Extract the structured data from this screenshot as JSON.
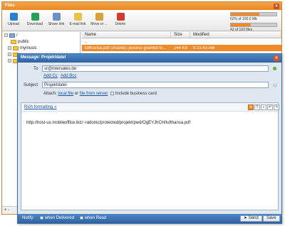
{
  "files_window": {
    "title": "Files",
    "toolbar": [
      {
        "label": "Upload",
        "icon": "upload-icon"
      },
      {
        "label": "Download",
        "icon": "download-icon"
      },
      {
        "label": "Share link",
        "icon": "share-link-icon"
      },
      {
        "label": "E-mail link",
        "icon": "email-link-icon"
      },
      {
        "label": "Move or ...",
        "icon": "move-icon"
      },
      {
        "label": "Delete",
        "icon": "delete-icon"
      }
    ],
    "quota": {
      "storage_text": "62% of 100.0 Mb",
      "storage_fraction": 0.62,
      "files_text": "43 of 100 files",
      "files_fraction": 0.43
    },
    "tree": {
      "root": "/",
      "items": [
        "public",
        "mymusic"
      ]
    },
    "columns": {
      "name": "Name",
      "size": "Size",
      "modified": "Modified"
    },
    "rows": [
      {
        "name": "..",
        "size": "",
        "modified": ""
      },
      {
        "name": "lufthansa.pdf (shared) (access granted to...",
        "size": "244 Kb",
        "modified": "8:15:43 AM"
      }
    ],
    "tree_bottom": "+ -"
  },
  "message_window": {
    "title": "Message: Projektdatei",
    "to_label": "To",
    "to_value": "sr@intersales.de",
    "add_cc": "Add Cc",
    "add_bcc": "Add Bcc",
    "subject_label": "Subject",
    "subject_value": "Projektdatei",
    "attach_label": "Attach:",
    "attach_local": "local file",
    "attach_or": "or",
    "attach_server": "file from server",
    "include_business_card": "Include business card",
    "rich_formatting": "Rich formatting »",
    "body": "http://host-us.mobileoffice.biz/~radonic/protected/projekt/pwd/OgEYJhCH/lufthansa.pdf",
    "notify_label": "Notify:",
    "when_delivered": "when Delivered",
    "when_read": "when Read",
    "send": "Send",
    "save": "Save"
  },
  "colors": {
    "files_accent": "#f08a28",
    "message_accent": "#2f62a0"
  }
}
